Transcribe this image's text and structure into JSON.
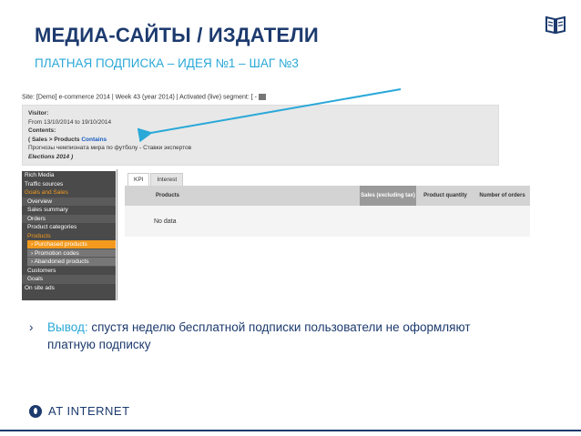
{
  "title": "МЕДИА-САЙТЫ / ИЗДАТЕЛИ",
  "subtitle": "ПЛАТНАЯ ПОДПИСКА – ИДЕЯ №1 – ШАГ №3",
  "screenshot": {
    "site_bar": "Site: [Demo] e-commerce 2014 | Week 43 (year 2014) | Activated (live) segment: [ -",
    "visitor": {
      "label": "Visitor:",
      "period": "From 13/10/2014 to 19/10/2014",
      "contents_label": "Contents:",
      "condition_prefix": "( Sales > Products ",
      "condition_op": "Contains",
      "value": "Прогнозы чемпионата мира по футболу - Ставки экспертов",
      "value_tail": "Elections 2014 )"
    },
    "sidebar": {
      "items": [
        {
          "label": "Rich Media"
        },
        {
          "label": "Traffic sources"
        },
        {
          "label": "Goals and Sales"
        },
        {
          "label": "Overview"
        },
        {
          "label": "Sales summary"
        },
        {
          "label": "Orders"
        },
        {
          "label": "Product categories"
        },
        {
          "label": "Products"
        },
        {
          "label": "› Purchased products"
        },
        {
          "label": "› Promotion codes"
        },
        {
          "label": "› Abandoned products"
        },
        {
          "label": "Customers"
        },
        {
          "label": "Goals"
        },
        {
          "label": "On site ads"
        }
      ]
    },
    "tabs": [
      "KPI",
      "Interest"
    ],
    "table": {
      "headers": [
        "Products",
        "Sales (excluding tax)",
        "Product quantity",
        "Number of orders"
      ],
      "empty_text": "No data"
    }
  },
  "conclusion": {
    "bullet": "›",
    "label": "Вывод:",
    "text": " спустя неделю бесплатной подписки пользователи не оформляют платную подписку"
  },
  "logo": {
    "text": "AT INTERNET"
  },
  "colors": {
    "title": "#1c3a6e",
    "accent": "#2aa8d8",
    "orange": "#f39a1e"
  },
  "icons": {
    "top_right": "book-icon",
    "logo": "drop-logo-icon"
  }
}
